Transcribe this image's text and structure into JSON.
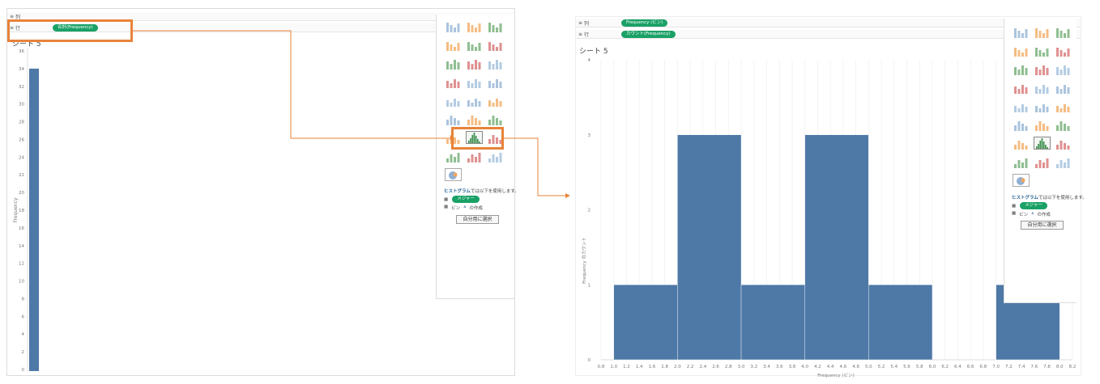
{
  "left": {
    "columns_shelf": {
      "icon": "≡",
      "label": "列"
    },
    "rows_shelf": {
      "icon": "≡",
      "label": "行",
      "pill": "合計(Frequency)"
    },
    "sheet_title": "シート 5",
    "y_axis_label": "Frequency",
    "y_ticks": [
      "36",
      "34",
      "32",
      "30",
      "28",
      "26",
      "24",
      "22",
      "20",
      "18",
      "16",
      "14",
      "12",
      "10",
      "8",
      "6",
      "4",
      "2",
      "0"
    ],
    "bar_value": 34,
    "y_max": 36
  },
  "right": {
    "columns_shelf": {
      "icon": "≡",
      "label": "列",
      "pill": "Frequency (ビン)"
    },
    "rows_shelf": {
      "icon": "≡",
      "label": "行",
      "pill": "カウント(Frequency)"
    },
    "sheet_title": "シート 5",
    "y_axis_label": "Frequency のカウント",
    "x_axis_label": "Frequency (ビン)",
    "y_ticks": [
      "4",
      "3",
      "2",
      "1",
      "0"
    ],
    "x_ticks": [
      "0.8",
      "1.0",
      "1.2",
      "1.4",
      "1.6",
      "1.8",
      "2.0",
      "2.2",
      "2.4",
      "2.6",
      "2.8",
      "3.0",
      "3.2",
      "3.4",
      "3.6",
      "3.8",
      "4.0",
      "4.2",
      "4.4",
      "4.6",
      "4.8",
      "5.0",
      "5.2",
      "5.4",
      "5.6",
      "5.8",
      "6.0",
      "6.2",
      "6.4",
      "6.6",
      "6.8",
      "7.0",
      "7.2",
      "7.4",
      "7.6",
      "7.8",
      "8.0",
      "8.2"
    ]
  },
  "chart_data": {
    "type": "bar",
    "x": [
      1.0,
      2.0,
      3.0,
      4.0,
      5.0,
      7.0
    ],
    "bin_width": 1.0,
    "values": [
      1,
      3,
      1,
      3,
      1,
      1
    ],
    "xlabel": "Frequency (ビン)",
    "ylabel": "Frequency のカウント",
    "xlim": [
      0.8,
      8.2
    ],
    "ylim": [
      0,
      4
    ]
  },
  "show_me": {
    "hint_chart": "ヒストグラム",
    "hint_rest": "では以下を使用します。",
    "measure_pill": "メジャー",
    "bin_text": "ビン",
    "create_text": "の作成",
    "button_label": "自分用に選択"
  },
  "colors": {
    "bar": "#4e79a7",
    "accent": "#e8833a",
    "pill": "#1aa166"
  }
}
